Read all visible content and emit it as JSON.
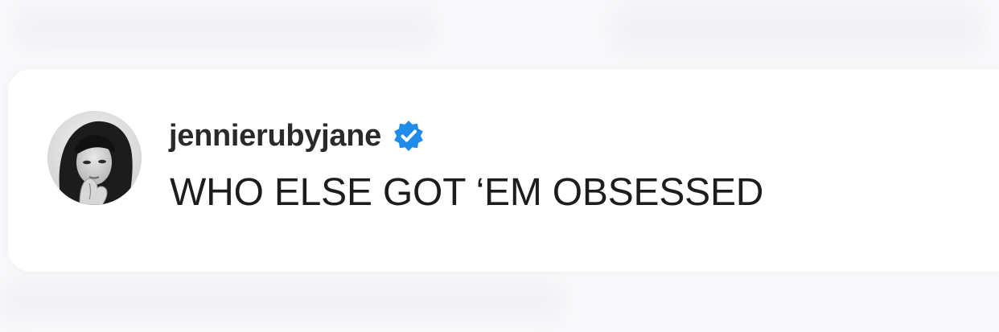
{
  "comment": {
    "avatar_icon": "profile-photo-icon",
    "username": "jennierubyjane",
    "verified_icon": "verified-badge-icon",
    "verified_color": "#1e8ce8",
    "text": "WHO ELSE GOT ‘EM OBSESSED"
  }
}
